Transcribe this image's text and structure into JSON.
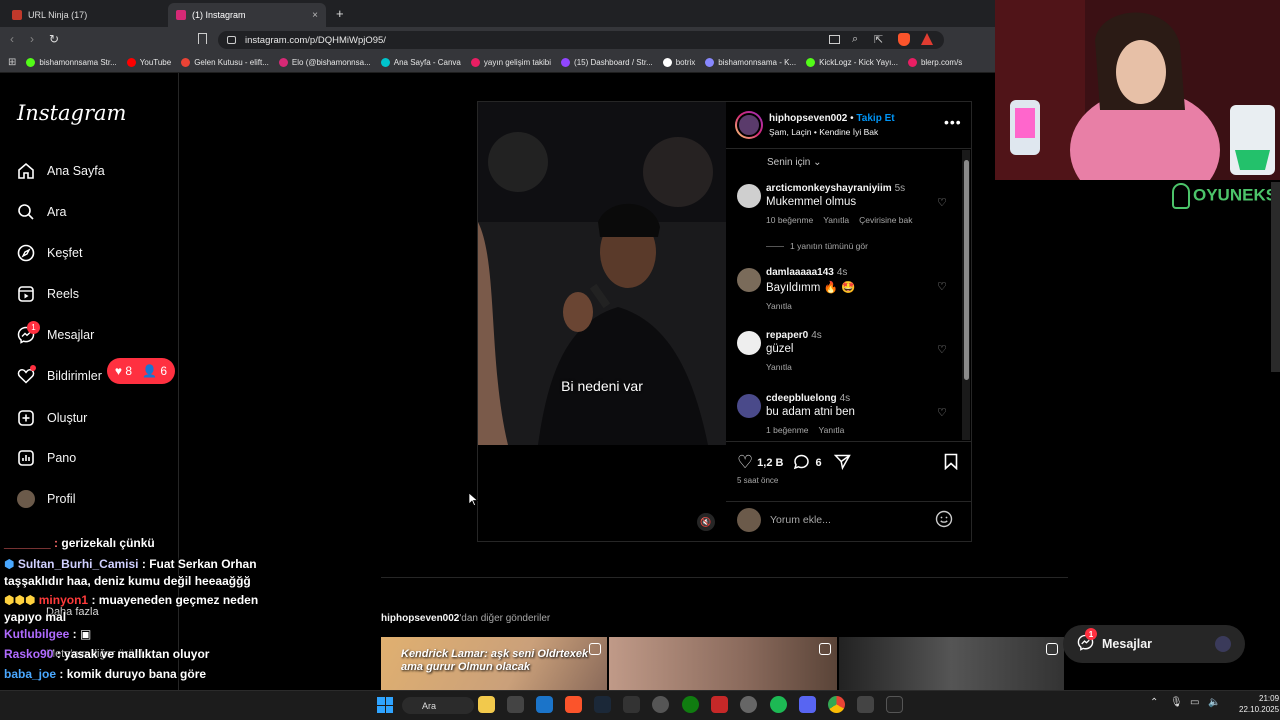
{
  "browser": {
    "tabs": [
      {
        "label": "URL Ninja (17)",
        "color": "#c0392b"
      },
      {
        "label": "(1) Instagram",
        "color": "#d62976"
      }
    ],
    "new_tab": "+",
    "close": "×",
    "url": "instagram.com/p/DQHMiWpjO95/",
    "bookmarks": [
      {
        "label": "bishamonnsama Str...",
        "color": "#53fc18"
      },
      {
        "label": "YouTube",
        "color": "#ff0000"
      },
      {
        "label": "Gelen Kutusu - elift...",
        "color": "#ea4335"
      },
      {
        "label": "Elo (@bishamonnsa...",
        "color": "#d62976"
      },
      {
        "label": "Ana Sayfa - Canva",
        "color": "#00c4cc"
      },
      {
        "label": "yayın gelişim takibi",
        "color": "#e91e63"
      },
      {
        "label": "(15) Dashboard / Str...",
        "color": "#9146ff"
      },
      {
        "label": "botrix",
        "color": "#ffffff"
      },
      {
        "label": "bishamonnsama - K...",
        "color": "#8888ff"
      },
      {
        "label": "KickLogz - Kick Yayı...",
        "color": "#53fc18"
      },
      {
        "label": "blerp.com/s",
        "color": "#e91e63"
      }
    ]
  },
  "sidebar": {
    "logo": "Instagram",
    "items": [
      {
        "label": "Ana Sayfa",
        "icon": "home-icon"
      },
      {
        "label": "Ara",
        "icon": "search-icon"
      },
      {
        "label": "Keşfet",
        "icon": "compass-icon"
      },
      {
        "label": "Reels",
        "icon": "reels-icon"
      },
      {
        "label": "Mesajlar",
        "icon": "messenger-icon",
        "badge": "1"
      },
      {
        "label": "Bildirimler",
        "icon": "heart-icon"
      },
      {
        "label": "Oluştur",
        "icon": "plus-icon"
      },
      {
        "label": "Pano",
        "icon": "dashboard-icon"
      },
      {
        "label": "Profil",
        "icon": "avatar"
      }
    ],
    "notif_pill": {
      "likes": "8",
      "follows": "6"
    },
    "more": "Daha fazla",
    "meta": "Meta'nın diğer ürünl..."
  },
  "post": {
    "username": "hiphopseven002",
    "follow": "Takip Et",
    "subline": "Şam, Laçin • Kendine İyi Bak",
    "video_caption": "Bi nedeni var",
    "sort_label": "Senin için",
    "comments": [
      {
        "user": "arcticmonkeyshayraniyiim",
        "time": "5s",
        "text": "Mukemmel olmus",
        "likes": "10 beğenme",
        "reply": "Yanıtla",
        "translate": "Çevirisine bak",
        "view_replies": "1 yanıtın tümünü gör",
        "av": "#cfcfcf"
      },
      {
        "user": "damlaaaaa143",
        "time": "4s",
        "text": "Bayıldımm 🔥 🤩",
        "reply": "Yanıtla",
        "av": "#7a6b5a"
      },
      {
        "user": "repaper0",
        "time": "4s",
        "text": "güzel",
        "reply": "Yanıtla",
        "av": "#eeeeee"
      },
      {
        "user": "cdeepbluelong",
        "time": "4s",
        "text": "bu adam atni ben",
        "likes": "1 beğenme",
        "reply": "Yanıtla",
        "av": "#4a4a8a"
      }
    ],
    "like_count": "1,2 B",
    "comment_count": "6",
    "time_ago": "5 saat önce",
    "add_comment": "Yorum ekle...",
    "more_posts_user": "hiphopseven002",
    "more_posts_suffix": "'dan diğer gönderiler",
    "thumb_text": "Kendrick Lamar: aşk seni Oldrtexek ama gurur Olmun olacak"
  },
  "messages_pill": {
    "label": "Mesajlar",
    "badge": "1"
  },
  "stream": {
    "logo": "OYUNEKS",
    "chat": [
      {
        "user": "",
        "sep": "",
        "text": "gerizekalı çünkü",
        "color": "#ff4444"
      },
      {
        "user": "Sultan_Burhi_Camisi",
        "sep": " : ",
        "text": "Fuat Serkan Orhan taşşaklıdır haa, deniz kumu değil heeaağğğ",
        "color": "#d0d0ff"
      },
      {
        "user": "minyon1",
        "sep": " : ",
        "text": "muayeneden geçmez neden yapıyo mal",
        "color": "#ff3b3b"
      },
      {
        "user": "Kutlubilgee",
        "sep": " :",
        "text": "",
        "color": "#b06bff"
      },
      {
        "user": "Rasko90",
        "sep": " : ",
        "text": "yasak ve mallıktan oluyor",
        "color": "#b06bff"
      },
      {
        "user": "baba_joe",
        "sep": " : ",
        "text": "komik duruyo bana göre",
        "color": "#4aa8ff"
      }
    ]
  },
  "taskbar": {
    "search": "Ara",
    "time": "21:09",
    "date": "22.10.2025"
  }
}
